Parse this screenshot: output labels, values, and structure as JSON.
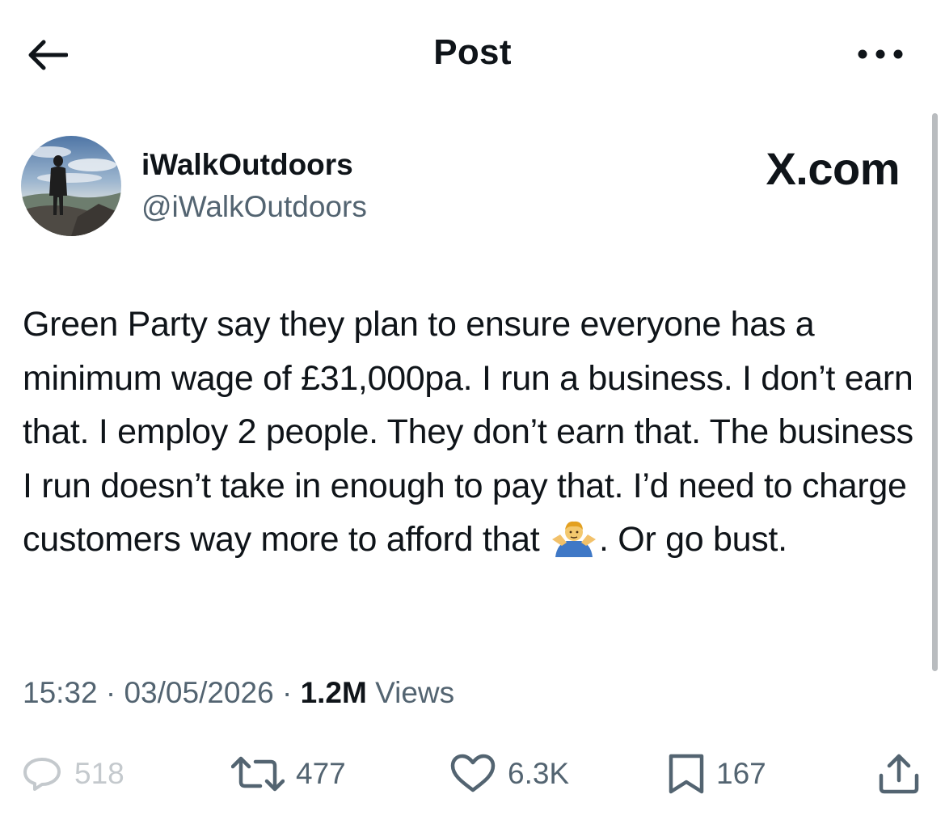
{
  "header": {
    "title": "Post"
  },
  "author": {
    "display_name": "iWalkOutdoors",
    "handle": "@iWalkOutdoors"
  },
  "brand": "X.com",
  "post": {
    "text_before_emoji": "Green Party say they plan to ensure everyone has a minimum wage of £31,000pa. I run a business. I don’t earn that. I employ 2 people. They don’t earn that. The business I run doesn’t take in enough to pay that. I’d need to charge customers way more to afford that ",
    "emoji": "person-shrugging",
    "text_after_emoji": ". Or go bust."
  },
  "meta": {
    "time": "15:32",
    "separator": "·",
    "date": "03/05/2026",
    "views_count": "1.2M",
    "views_label": "Views"
  },
  "actions": {
    "replies": "518",
    "reposts": "477",
    "likes": "6.3K",
    "bookmarks": "167"
  },
  "icons": {
    "back": "arrow-left-icon",
    "more": "more-horizontal-icon",
    "reply": "reply-icon",
    "repost": "repost-icon",
    "like": "heart-icon",
    "bookmark": "bookmark-icon",
    "share": "share-icon"
  },
  "colors": {
    "text_primary": "#0f1419",
    "text_secondary": "#536471",
    "background": "#ffffff"
  }
}
